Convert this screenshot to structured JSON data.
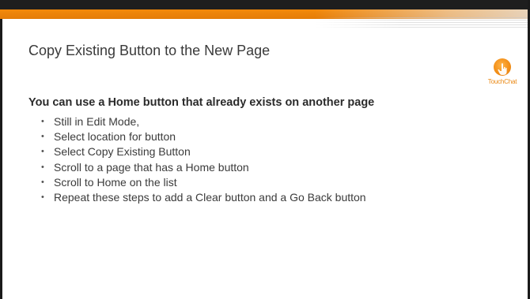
{
  "slide": {
    "title": "Copy Existing Button to the New Page",
    "heading": "You can use a Home button that already exists on another page",
    "bullets": [
      "Still in Edit Mode,",
      "Select location for button",
      "Select Copy Existing Button",
      "Scroll to a page that has a Home button",
      "Scroll to Home on the list",
      "Repeat these steps to add a Clear button and a Go Back button"
    ],
    "bullet_glyph": "•"
  },
  "logo": {
    "text": "TouchChat",
    "icon": "hand-touch-icon"
  },
  "colors": {
    "accent": "#f08a0c",
    "dark": "#1e1e1e",
    "title_text": "#3a3a3a",
    "body_text": "#3b3b3b"
  }
}
